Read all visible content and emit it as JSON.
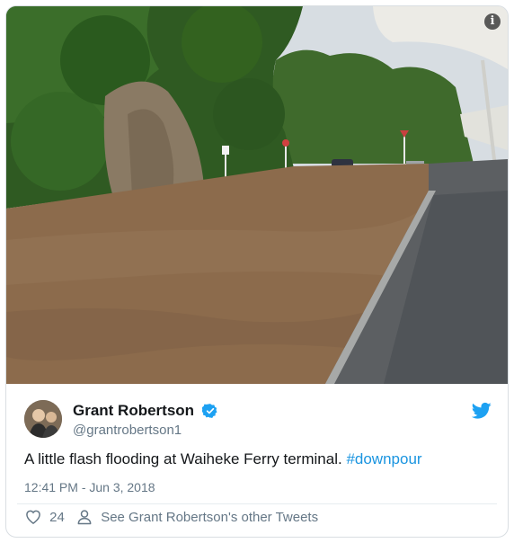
{
  "tweet": {
    "author": {
      "display_name": "Grant Robertson",
      "handle": "@grantrobertson1",
      "verified": true
    },
    "text": "A little flash flooding at Waiheke Ferry terminal.",
    "hashtag": "#downpour",
    "timestamp": "12:41 PM - Jun 3, 2018",
    "likes": "24",
    "other_tweets_link": "See Grant Robertson's other Tweets"
  },
  "colors": {
    "link_blue": "#1b95e0",
    "twitter_blue": "#1da1f2",
    "muted_text": "#657786",
    "primary_text": "#14171a"
  },
  "icons": {
    "info": "info-icon",
    "verified": "verified-badge-icon",
    "brand": "twitter-bird-icon",
    "like": "heart-icon",
    "profile": "person-icon"
  }
}
